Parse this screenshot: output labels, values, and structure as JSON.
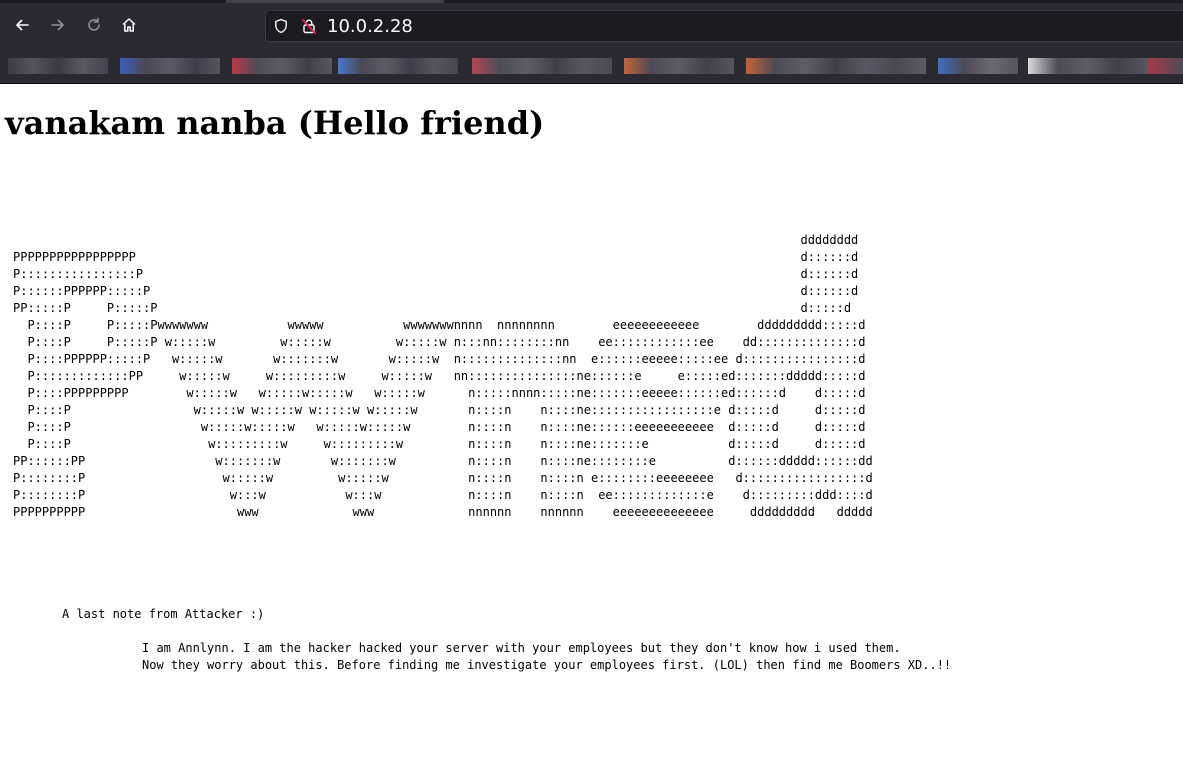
{
  "browser": {
    "url": "10.0.2.28",
    "icons": {
      "back": "arrow-left-icon",
      "forward": "arrow-right-icon",
      "reload": "reload-icon",
      "home": "home-icon",
      "shield": "shield-icon",
      "lock": "insecure-lock-icon"
    },
    "colors": {
      "toolbar": "#2b2a33",
      "urlbar": "#1c1b22",
      "insecure_slash": "#e22850"
    }
  },
  "page": {
    "heading": "vanakam nanba (Hello friend)",
    "ascii_art": "                                                                                                             dddddddd\nPPPPPPPPPPPPPPPPP                                                                                            d::::::d\nP::::::::::::::::P                                                                                           d::::::d\nP::::::PPPPPP:::::P                                                                                          d::::::d\nPP:::::P     P:::::P                                                                                         d:::::d\n  P::::P     P:::::Pwwwwwww           wwwww           wwwwwwwnnnn  nnnnnnnn        eeeeeeeeeeee        ddddddddd:::::d\n  P::::P     P:::::P w:::::w         w:::::w         w:::::w n:::nn::::::::nn    ee::::::::::::ee    dd::::::::::::::d\n  P::::PPPPPP:::::P   w:::::w       w:::::::w       w:::::w  n::::::::::::::nn  e::::::eeeee:::::ee d::::::::::::::::d\n  P:::::::::::::PP     w:::::w     w:::::::::w     w:::::w   nn:::::::::::::::ne::::::e     e:::::ed:::::::ddddd:::::d\n  P::::PPPPPPPPP        w:::::w   w:::::w:::::w   w:::::w      n:::::nnnn:::::ne:::::::eeeee::::::ed::::::d    d:::::d\n  P::::P                 w:::::w w:::::w w:::::w w:::::w       n::::n    n::::ne:::::::::::::::::e d:::::d     d:::::d\n  P::::P                  w:::::w:::::w   w:::::w:::::w        n::::n    n::::ne::::::eeeeeeeeeee  d:::::d     d:::::d\n  P::::P                   w:::::::::w     w:::::::::w         n::::n    n::::ne:::::::e           d:::::d     d:::::d\nPP::::::PP                  w:::::::w       w:::::::w          n::::n    n::::ne::::::::e          d::::::ddddd::::::dd\nP::::::::P                   w:::::w         w:::::w           n::::n    n::::n e::::::::eeeeeeee   d:::::::::::::::::d\nP::::::::P                    w:::w           w:::w            n::::n    n::::n  ee:::::::::::::e    d:::::::::ddd::::d\nPPPPPPPPPP                     www             www             nnnnnn    nnnnnn    eeeeeeeeeeeeee     ddddddddd   ddddd",
    "note_title": "A last note from Attacker :)",
    "message_line1": "I am Annlynn. I am the hacker hacked your server with your employees but they don't know how i used them.",
    "message_line2": "Now they worry about this. Before finding me investigate your employees first. (LOL) then find me Boomers XD..!!"
  }
}
